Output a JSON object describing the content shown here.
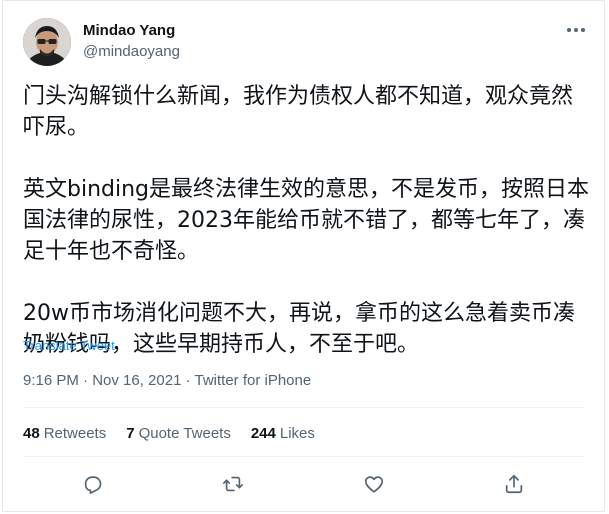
{
  "author": {
    "name": "Mindao Yang",
    "handle": "@mindaoyang"
  },
  "tweet": {
    "paragraph1": "门头沟解锁什么新闻，我作为债权人都不知道，观众竟然吓尿。",
    "paragraph2": "英文binding是最终法律生效的意思，不是发币，按照日本国法律的尿性，2023年能给币就不错了，都等七年了，凑足十年也不奇怪。",
    "paragraph3": "20w币市场消化问题不大，再说，拿币的这么急着卖币凑奶粉钱吗，这些早期持币人，不至于吧。",
    "translate_label": "Translate Tweet",
    "timestamp": "9:16 PM · Nov 16, 2021 · Twitter for iPhone"
  },
  "stats": {
    "retweets_count": "48",
    "retweets_label": "Retweets",
    "quotes_count": "7",
    "quotes_label": "Quote Tweets",
    "likes_count": "244",
    "likes_label": "Likes"
  },
  "icons": {
    "reply": "reply-icon",
    "retweet": "retweet-icon",
    "like": "heart-icon",
    "share": "share-icon",
    "more": "more-icon"
  },
  "colors": {
    "accent": "#1d9bf0",
    "secondary_text": "#536471",
    "primary_text": "#0f1419"
  }
}
